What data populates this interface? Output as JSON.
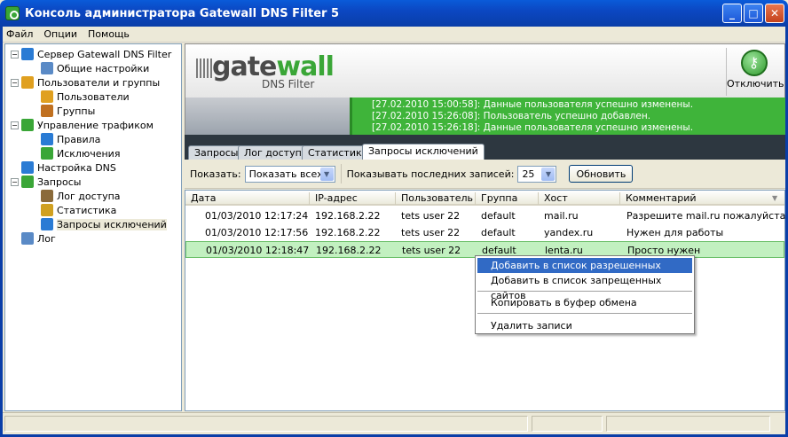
{
  "window": {
    "title": "Консоль администратора Gatewall DNS Filter 5"
  },
  "menu": [
    "Файл",
    "Опции",
    "Помощь"
  ],
  "tree": [
    {
      "label": "Сервер Gatewall DNS Filter",
      "icon": "server-icon",
      "exp": "−"
    },
    {
      "label": "Общие настройки",
      "icon": "settings-icon"
    },
    {
      "label": "Пользователи и группы",
      "icon": "users-groups-icon",
      "exp": "−"
    },
    {
      "label": "Пользователи",
      "icon": "user-icon"
    },
    {
      "label": "Группы",
      "icon": "group-icon"
    },
    {
      "label": "Управление трафиком",
      "icon": "traffic-icon",
      "exp": "−"
    },
    {
      "label": "Правила",
      "icon": "rules-icon"
    },
    {
      "label": "Исключения",
      "icon": "exceptions-icon"
    },
    {
      "label": "Настройка DNS",
      "icon": "dns-icon"
    },
    {
      "label": "Запросы",
      "icon": "requests-icon",
      "exp": "−"
    },
    {
      "label": "Лог доступа",
      "icon": "access-log-icon"
    },
    {
      "label": "Статистика",
      "icon": "statistics-icon"
    },
    {
      "label": "Запросы исключений",
      "icon": "exception-requests-icon"
    },
    {
      "label": "Лог",
      "icon": "log-icon"
    }
  ],
  "banner": {
    "logo_gate": "gate",
    "logo_wall": "wall",
    "subtitle": "DNS Filter",
    "disconnect_label": "Отключить"
  },
  "log_lines": [
    "[27.02.2010 15:00:58]: Данные пользователя успешно изменены.",
    "[27.02.2010 15:26:08]: Пользователь успешно добавлен.",
    "[27.02.2010 15:26:18]: Данные пользователя успешно изменены."
  ],
  "tabs": [
    "Запросы",
    "Лог доступа",
    "Статистика",
    "Запросы исключений"
  ],
  "active_tab": "Запросы исключений",
  "toolbar": {
    "show_label": "Показать:",
    "show_value": "Показать всех",
    "last_label": "Показывать последних записей:",
    "last_value": "25",
    "refresh_label": "Обновить"
  },
  "table": {
    "columns": [
      "Дата",
      "IP-адрес",
      "Пользователь",
      "Группа",
      "Хост",
      "Комментарий"
    ],
    "rows": [
      [
        "01/03/2010 12:17:24",
        "192.168.2.22",
        "tets user 22",
        "default",
        "mail.ru",
        "Разрешите mail.ru пожалуйста"
      ],
      [
        "01/03/2010 12:17:56",
        "192.168.2.22",
        "tets user 22",
        "default",
        "yandex.ru",
        "Нужен для работы"
      ],
      [
        "01/03/2010 12:18:47",
        "192.168.2.22",
        "tets user 22",
        "default",
        "lenta.ru",
        "Просто нужен"
      ]
    ]
  },
  "context_menu": [
    "Добавить в список разрешенных сайтов",
    "Добавить в список запрещенных сайтов",
    "Копировать в буфер обмена",
    "Удалить записи"
  ],
  "colors": {
    "accent_green": "#3fb43a",
    "selection_blue": "#316ac5",
    "title_blue": "#0a47c2"
  }
}
